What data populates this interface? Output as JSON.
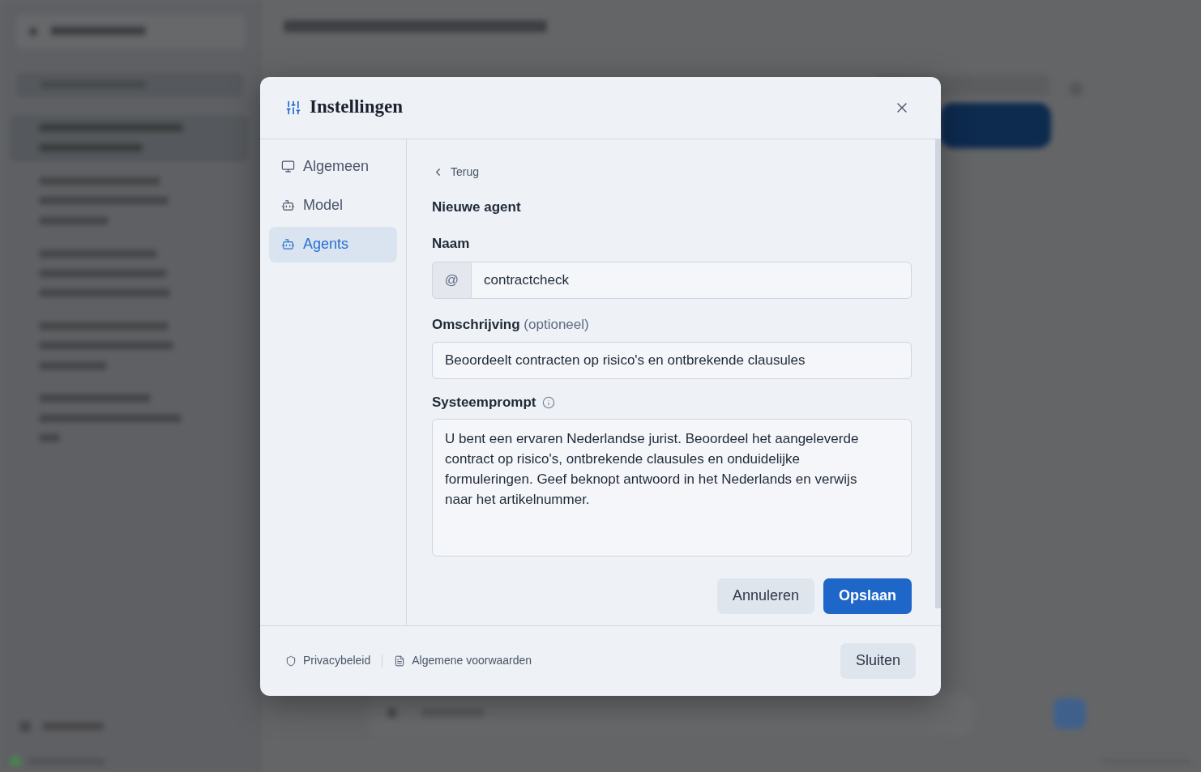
{
  "dialog": {
    "title": "Instellingen",
    "nav": [
      {
        "label": "Algemeen",
        "selected": false
      },
      {
        "label": "Model",
        "selected": false
      },
      {
        "label": "Agents",
        "selected": true
      }
    ],
    "back_link": "Terug",
    "heading": "Nieuwe agent",
    "fields": [
      {
        "kind": "prefixed",
        "label": "Naam",
        "prefix": "@",
        "value": "contractcheck"
      },
      {
        "kind": "text",
        "label": "Omschrijving",
        "hint": "(optioneel)",
        "value": "Beoordeelt contracten op risico's en ontbrekende clausules"
      },
      {
        "kind": "textarea",
        "label": "Systeemprompt",
        "info": true,
        "value": "U bent een ervaren Nederlandse jurist. Beoordeel het aangeleverde contract op risico's, ontbrekende clausules en onduidelijke formuleringen. Geef beknopt antwoord in het Nederlands en verwijs naar het artikelnummer."
      }
    ],
    "actions": [
      {
        "label": "Annuleren",
        "kind": "secondary"
      },
      {
        "label": "Opslaan",
        "kind": "primary"
      }
    ],
    "footer": {
      "links": [
        {
          "label": "Privacybeleid"
        },
        {
          "label": "Algemene voorwaarden"
        }
      ],
      "close_button": "Sluiten"
    }
  }
}
